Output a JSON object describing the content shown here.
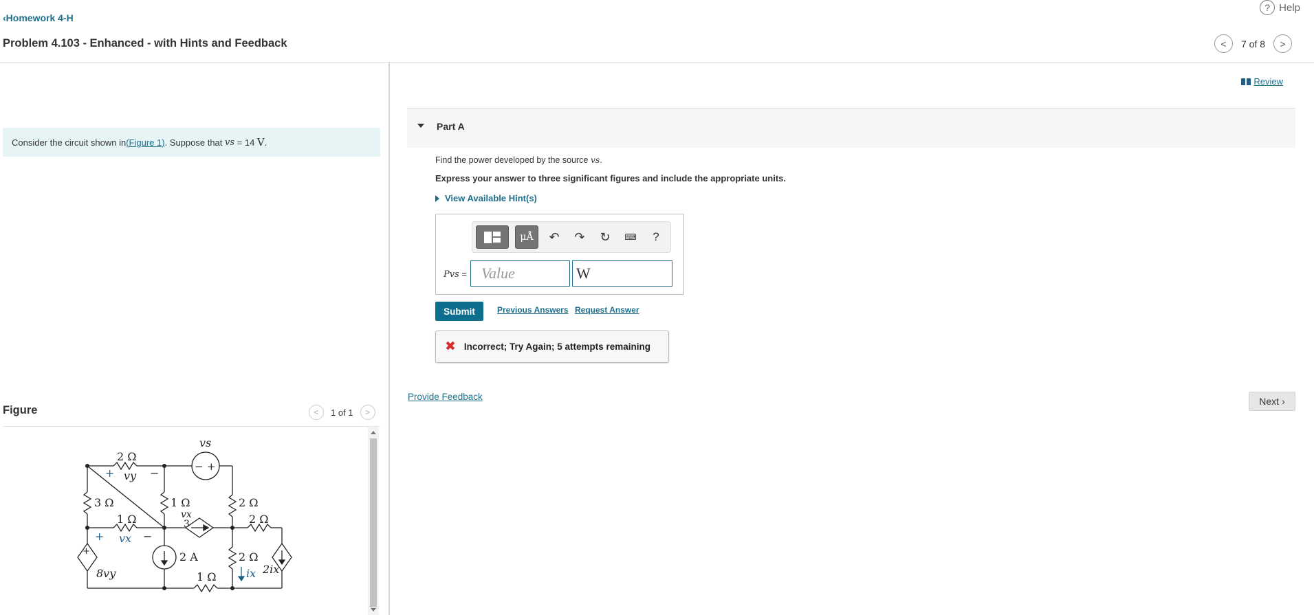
{
  "header": {
    "help_label": "Help",
    "help_icon": "?",
    "back_label": "Homework 4-H",
    "back_icon": "‹",
    "title": "Problem 4.103 - Enhanced - with Hints and Feedback",
    "pager_text": "7 of 8",
    "prev_icon": "<",
    "next_icon": ">"
  },
  "left": {
    "prompt_before": "Consider the circuit shown in ",
    "prompt_link": "(Figure 1)",
    "prompt_mid": ". Suppose that ",
    "prompt_var": "vs",
    "prompt_eq": " = 14 ",
    "prompt_unit": "V",
    "prompt_end": ".",
    "figure_title": "Figure",
    "figure_pager": "1 of 1",
    "circuit": {
      "r_top": "2 Ω",
      "vy_plus": "+",
      "vy": "vy",
      "vy_minus": "−",
      "vs": "vs",
      "src_minus": "−",
      "src_plus": "+",
      "r_left": "3 Ω",
      "r_mid": "1 Ω",
      "vx_over": "vx",
      "three": "3",
      "r_right_top": "2 Ω",
      "r_low": "1 Ω",
      "vx_plus": "+",
      "vx": "vx",
      "vx_minus": "−",
      "r_right_mid": "2 Ω",
      "cur_src": "2 A",
      "r_right_low": "2 Ω",
      "ix": "ix",
      "two_ix": "2ix",
      "eight_vy": "8vy",
      "dep_plus": "+",
      "r_bottom": "1 Ω"
    }
  },
  "right": {
    "review_label": "Review",
    "part_label": "Part A",
    "question_before": "Find the power developed by the source ",
    "question_var": "vs",
    "question_end": ".",
    "instruction": "Express your answer to three significant figures and include the appropriate units.",
    "hints_label": "View Available Hint(s)",
    "toolbar": {
      "units_label": "μÅ",
      "undo_icon": "↶",
      "redo_icon": "↷",
      "reset_icon": "↻",
      "keyboard_icon": "⌨",
      "help_icon": "?"
    },
    "answer_label": "Pvs",
    "answer_eq": " =",
    "value_placeholder": "Value",
    "unit_value": "W",
    "submit_label": "Submit",
    "previous_answers_label": "Previous Answers",
    "request_answer_label": "Request Answer",
    "feedback_icon": "✖",
    "feedback_text": "Incorrect; Try Again; 5 attempts remaining",
    "provide_feedback_label": "Provide Feedback",
    "next_label": "Next",
    "next_icon": "›"
  }
}
